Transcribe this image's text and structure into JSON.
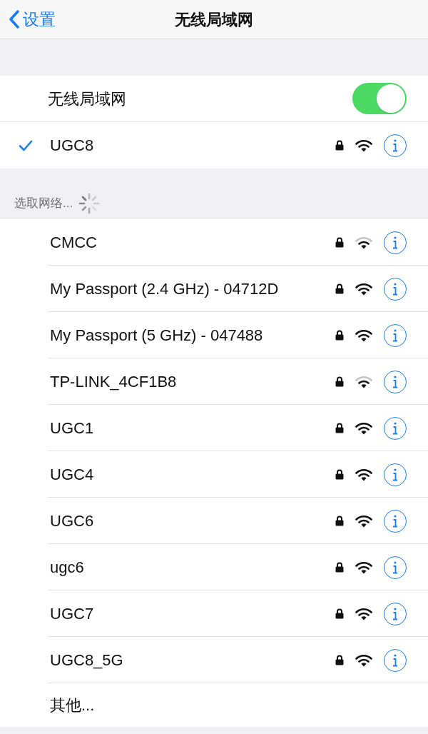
{
  "nav": {
    "back": "设置",
    "title": "无线局域网"
  },
  "wifi_toggle": {
    "label": "无线局域网",
    "on": true
  },
  "connected": {
    "name": "UGC8",
    "selected": true,
    "locked": true,
    "weak_signal": false
  },
  "section_header": "选取网络...",
  "networks": [
    {
      "name": "CMCC",
      "locked": true,
      "weak_signal": true
    },
    {
      "name": "My Passport (2.4 GHz) - 04712D",
      "locked": true,
      "weak_signal": false
    },
    {
      "name": "My Passport (5 GHz) - 047488",
      "locked": true,
      "weak_signal": false
    },
    {
      "name": "TP-LINK_4CF1B8",
      "locked": true,
      "weak_signal": true
    },
    {
      "name": "UGC1",
      "locked": true,
      "weak_signal": false
    },
    {
      "name": "UGC4",
      "locked": true,
      "weak_signal": false
    },
    {
      "name": "UGC6",
      "locked": true,
      "weak_signal": false
    },
    {
      "name": "ugc6",
      "locked": true,
      "weak_signal": false
    },
    {
      "name": "UGC7",
      "locked": true,
      "weak_signal": false
    },
    {
      "name": "UGC8_5G",
      "locked": true,
      "weak_signal": false
    }
  ],
  "other": "其他..."
}
